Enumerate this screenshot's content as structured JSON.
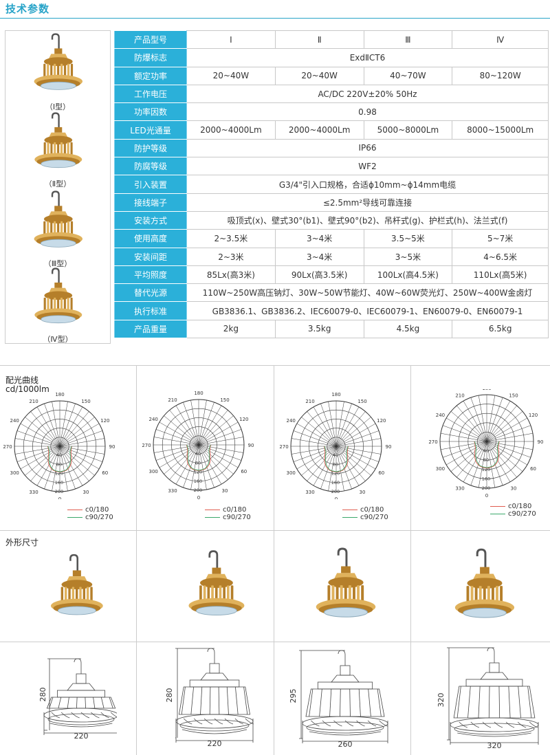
{
  "header": {
    "title": "技术参数"
  },
  "models": [
    {
      "caption": "（Ⅰ型）"
    },
    {
      "caption": "（Ⅱ型）"
    },
    {
      "caption": "（Ⅲ型）"
    },
    {
      "caption": "（Ⅳ型）"
    }
  ],
  "spec_table": {
    "rows": [
      {
        "label": "产品型号",
        "cells": [
          "Ⅰ",
          "Ⅱ",
          "Ⅲ",
          "Ⅳ"
        ]
      },
      {
        "label": "防爆标志",
        "cells": [
          "ExdⅡCT6"
        ]
      },
      {
        "label": "额定功率",
        "cells": [
          "20~40W",
          "20~40W",
          "40~70W",
          "80~120W"
        ]
      },
      {
        "label": "工作电压",
        "cells": [
          "AC/DC 220V±20%    50Hz"
        ]
      },
      {
        "label": "功率因数",
        "cells": [
          "0.98"
        ]
      },
      {
        "label": "LED光通量",
        "cells": [
          "2000~4000Lm",
          "2000~4000Lm",
          "5000~8000Lm",
          "8000~15000Lm"
        ]
      },
      {
        "label": "防护等级",
        "cells": [
          "IP66"
        ]
      },
      {
        "label": "防腐等级",
        "cells": [
          "WF2"
        ]
      },
      {
        "label": "引入装置",
        "cells": [
          "G3/4\"引入口规格，合适ϕ10mm~ϕ14mm电缆"
        ]
      },
      {
        "label": "接线端子",
        "cells": [
          "≤2.5mm²导线可靠连接"
        ]
      },
      {
        "label": "安装方式",
        "cells": [
          "吸顶式(x)、壁式30°(b1)、壁式90°(b2)、吊杆式(g)、护栏式(h)、法兰式(f)"
        ]
      },
      {
        "label": "使用高度",
        "cells": [
          "2~3.5米",
          "3~4米",
          "3.5~5米",
          "5~7米"
        ]
      },
      {
        "label": "安装间距",
        "cells": [
          "2~3米",
          "3~4米",
          "3~5米",
          "4~6.5米"
        ]
      },
      {
        "label": "平均照度",
        "cells": [
          "85Lx(高3米)",
          "90Lx(高3.5米)",
          "100Lx(高4.5米)",
          "110Lx(高5米)"
        ]
      },
      {
        "label": "替代光源",
        "cells": [
          "110W~250W高压钠灯、30W~50W节能灯、40W~60W荧光灯、250W~400W金卤灯"
        ]
      },
      {
        "label": "执行标准",
        "cells": [
          "GB3836.1、GB3836.2、IEC60079-0、IEC60079-1、EN60079-0、EN60079-1"
        ]
      },
      {
        "label": "产品重量",
        "cells": [
          "2kg",
          "3.5kg",
          "4.5kg",
          "6.5kg"
        ]
      }
    ]
  },
  "light_distribution": {
    "title": "配光曲线",
    "unit": "cd/1000lm",
    "angle_labels": [
      "180",
      "150",
      "120",
      "90",
      "60",
      "30",
      "0",
      "330",
      "300",
      "270",
      "240",
      "210"
    ],
    "radial_labels": [
      "40",
      "80",
      "120",
      "160",
      "200"
    ],
    "legend": [
      {
        "name": "c0/180",
        "color": "#e05a4e"
      },
      {
        "name": "c90/270",
        "color": "#3aa86a"
      }
    ]
  },
  "dimensions": {
    "title": "外形尺寸",
    "items": [
      {
        "height": "280",
        "width": "220"
      },
      {
        "height": "280",
        "width": "220"
      },
      {
        "height": "295",
        "width": "260"
      },
      {
        "height": "320",
        "width": "320"
      }
    ]
  },
  "colors": {
    "accent": "#2bb0d9",
    "title": "#27a3c8",
    "lamp_body": "#e0b25c",
    "lamp_shadow": "#b57f2a",
    "lens": "#c7dbe8"
  }
}
